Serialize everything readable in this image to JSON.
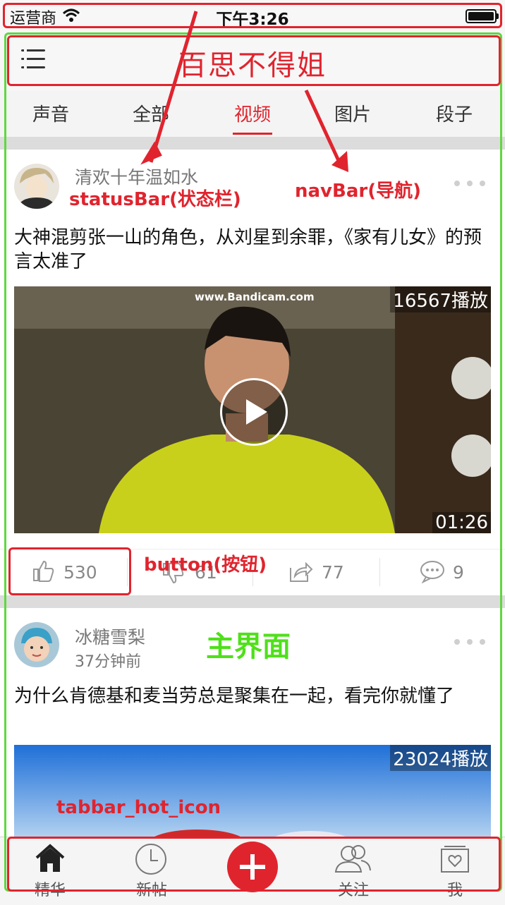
{
  "status_bar": {
    "carrier": "运营商",
    "time": "下午3:26"
  },
  "nav_bar": {
    "title": "百思不得姐"
  },
  "tabs": [
    {
      "label": "声音",
      "active": false
    },
    {
      "label": "全部",
      "active": false
    },
    {
      "label": "视频",
      "active": true
    },
    {
      "label": "图片",
      "active": false
    },
    {
      "label": "段子",
      "active": false
    }
  ],
  "posts": [
    {
      "author": "清欢十年温如水",
      "subtitle": "",
      "text": "大神混剪张一山的角色，从刘星到余罪，《家有儿女》的预言太准了",
      "play_count": "16567播放",
      "duration": "01:26",
      "watermark": "www.Bandicam.com",
      "likes": "530",
      "dislikes": "61",
      "shares": "77",
      "comments": "9"
    },
    {
      "author": "冰糖雪梨",
      "subtitle": "37分钟前",
      "text": "为什么肯德基和麦当劳总是聚集在一起，看完你就懂了",
      "play_count": "23024播放"
    }
  ],
  "tabbar": [
    {
      "label": "精华",
      "icon": "home-icon"
    },
    {
      "label": "新帖",
      "icon": "clock-icon"
    },
    {
      "label": "",
      "icon": "plus-icon"
    },
    {
      "label": "关注",
      "icon": "people-icon"
    },
    {
      "label": "我",
      "icon": "profile-icon"
    }
  ],
  "annotations": {
    "status_bar": "statusBar(状态栏)",
    "nav_bar": "navBar(导航)",
    "button": "button(按钮)",
    "main": "主界面",
    "tabbar_icon": "tabbar_hot_icon"
  },
  "colors": {
    "accent": "#e0242e",
    "annotation_red": "#e0242e",
    "annotation_green": "#60d840"
  }
}
